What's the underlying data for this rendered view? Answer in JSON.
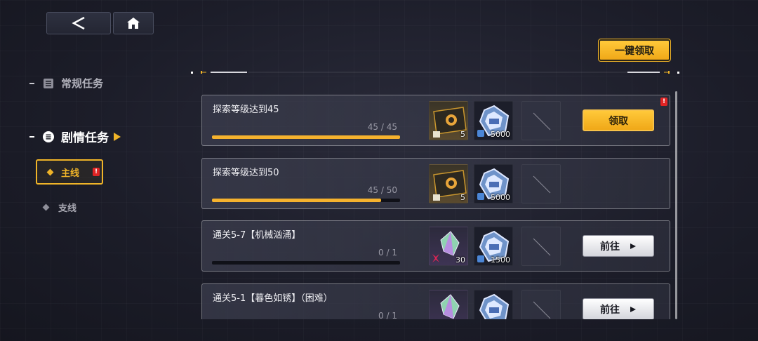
{
  "nav": {
    "back_icon": "chevron-left-icon",
    "home_icon": "home-icon"
  },
  "sidebar": {
    "categories": [
      {
        "label": "常规任务",
        "icon": "list-icon"
      },
      {
        "label": "剧情任务",
        "icon": "story-icon"
      }
    ],
    "subcategories": [
      {
        "label": "主线",
        "badge": "!"
      },
      {
        "label": "支线"
      }
    ]
  },
  "claim_all_label": "一键领取",
  "tasks": [
    {
      "title": "探索等级达到45",
      "progress_text": "45 / 45",
      "progress": 1.0,
      "rewards": [
        {
          "icon": "gold-ticket-icon",
          "count": "5"
        },
        {
          "icon": "blue-crystal-icon",
          "count": "5000"
        },
        {
          "icon": "empty-slot",
          "count": ""
        }
      ],
      "action": {
        "label": "领取",
        "type": "claim"
      },
      "badge": "!"
    },
    {
      "title": "探索等级达到50",
      "progress_text": "45 / 50",
      "progress": 0.9,
      "rewards": [
        {
          "icon": "gold-ticket-icon",
          "count": "5"
        },
        {
          "icon": "blue-crystal-icon",
          "count": "5000"
        },
        {
          "icon": "empty-slot",
          "count": ""
        }
      ],
      "action": null
    },
    {
      "title": "通关5-7【机械汹涌】",
      "progress_text": "0 / 1",
      "progress": 0.0,
      "rewards": [
        {
          "icon": "prism-shard-icon",
          "count": "30"
        },
        {
          "icon": "blue-crystal-icon",
          "count": "1500"
        },
        {
          "icon": "empty-slot",
          "count": ""
        }
      ],
      "action": {
        "label": "前往",
        "type": "go"
      }
    },
    {
      "title": "通关5-1【暮色如锈】（困难）",
      "progress_text": "0 / 1",
      "progress": 0.0,
      "rewards": [
        {
          "icon": "prism-shard-icon",
          "count": ""
        },
        {
          "icon": "blue-crystal-icon",
          "count": ""
        },
        {
          "icon": "empty-slot",
          "count": ""
        }
      ],
      "action": {
        "label": "前往",
        "type": "go"
      }
    }
  ],
  "colors": {
    "accent": "#f0b428",
    "badge": "#e02424",
    "bar": "#f5b22e"
  }
}
